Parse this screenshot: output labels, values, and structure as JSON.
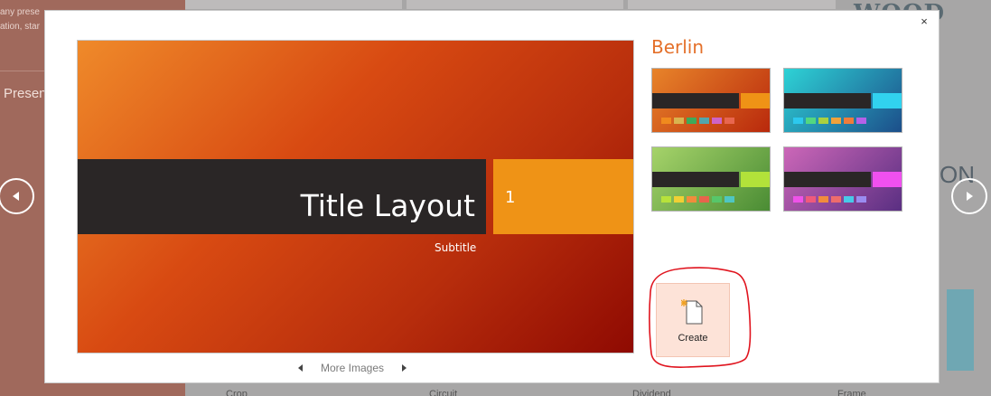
{
  "background": {
    "left_text": "any prese\nation, star",
    "left_presen": "Presen",
    "woodtype_text": "WOOD TYPE",
    "on_text": "ON",
    "bottom_labels": [
      "Crop",
      "Circuit",
      "Dividend",
      "Frame"
    ]
  },
  "dialog": {
    "close_glyph": "×",
    "preview": {
      "title": "Title Layout",
      "slide_number": "1",
      "subtitle": "Subtitle"
    },
    "more_images_label": "More Images",
    "theme_name": "Berlin",
    "variants": [
      {
        "name": "orange",
        "gradient": [
          "#e8842a",
          "#b9290c"
        ],
        "accent": "#ef9316",
        "swatches": [
          "#f08a1e",
          "#d9b34f",
          "#3eaa5a",
          "#52a6ad",
          "#ce63c6",
          "#e8664e"
        ]
      },
      {
        "name": "teal",
        "gradient": [
          "#2ed3d6",
          "#1c4e8a"
        ],
        "accent": "#31d2ef",
        "swatches": [
          "#2cc9ee",
          "#53d780",
          "#aad03f",
          "#f0a23a",
          "#ef7c3a",
          "#b561e8"
        ]
      },
      {
        "name": "green",
        "gradient": [
          "#a6d36a",
          "#4a8c34"
        ],
        "accent": "#b2e23a",
        "swatches": [
          "#b7e23b",
          "#f0d034",
          "#f18c3c",
          "#e7644c",
          "#57c66a",
          "#4fc6c2"
        ]
      },
      {
        "name": "purple",
        "gradient": [
          "#cc67b8",
          "#5a2f82"
        ],
        "accent": "#f050ef",
        "swatches": [
          "#ef52e9",
          "#ef5a7c",
          "#f28c3c",
          "#ee6c6c",
          "#48c9e8",
          "#9a8cf0"
        ]
      }
    ],
    "create_label": "Create"
  },
  "colors": {
    "accent_theme_name": "#e4702a",
    "annotation_red": "#e0141e"
  }
}
